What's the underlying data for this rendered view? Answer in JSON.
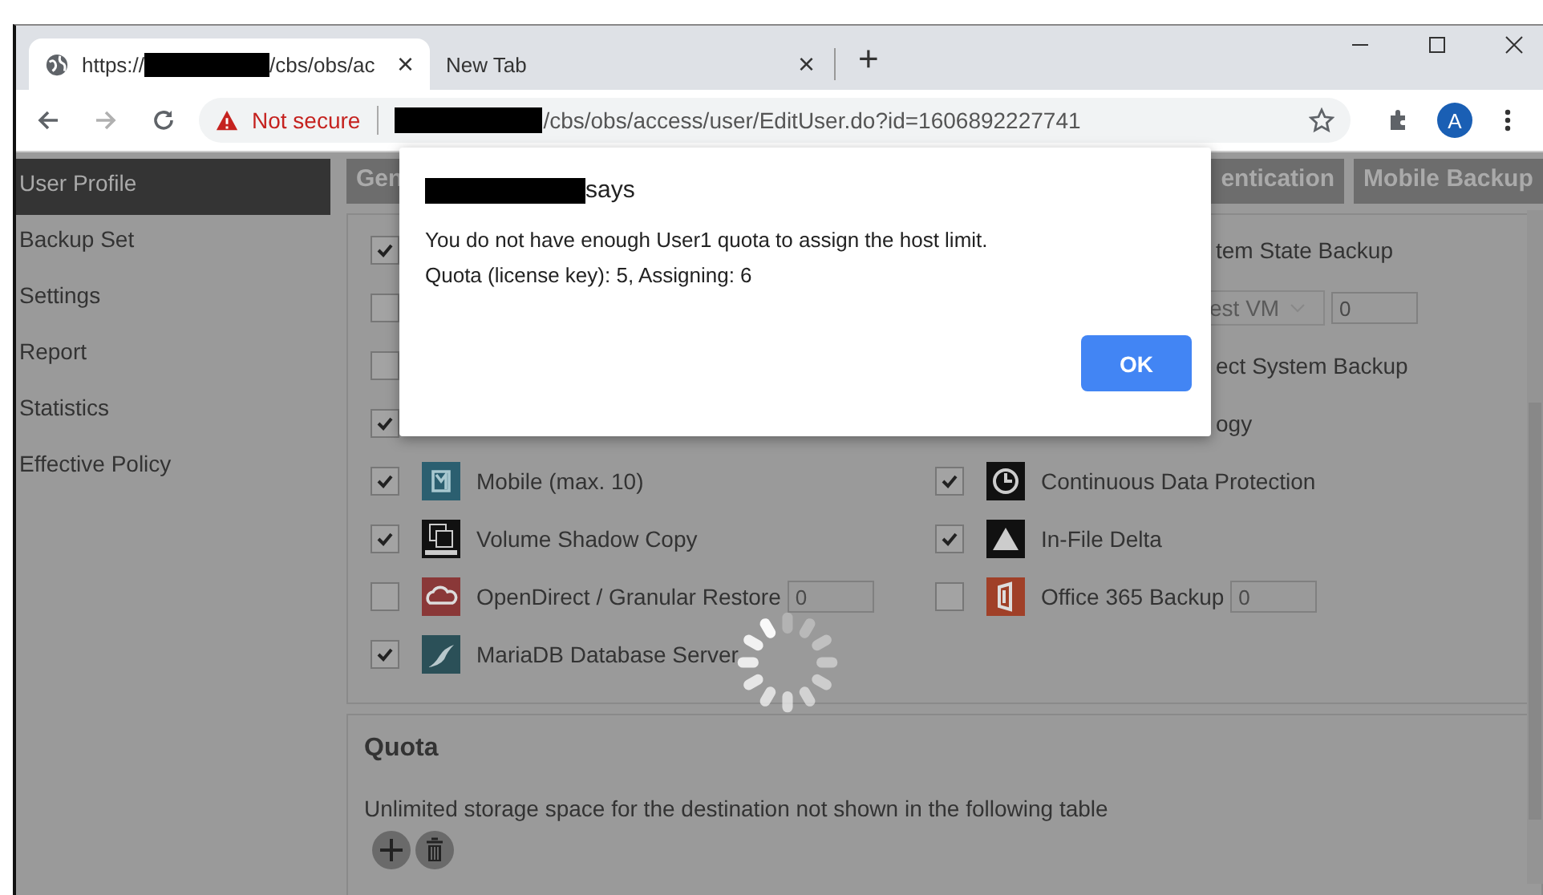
{
  "browser": {
    "tabs": [
      {
        "prefix": "https://",
        "suffix": "/cbs/obs/ac",
        "close": "×",
        "selected": true
      },
      {
        "title": "New Tab",
        "close": "×",
        "selected": false
      }
    ],
    "new_tab": "+",
    "security": "Not secure",
    "url_path": "/cbs/obs/access/user/EditUser.do?id=1606892227741",
    "profile": "A"
  },
  "sidebar": {
    "items": [
      {
        "label": "User Profile",
        "selected": true
      },
      {
        "label": "Backup Set",
        "selected": false
      },
      {
        "label": "Settings",
        "selected": false
      },
      {
        "label": "Report",
        "selected": false
      },
      {
        "label": "Statistics",
        "selected": false
      },
      {
        "label": "Effective Policy",
        "selected": false
      }
    ]
  },
  "tabs": [
    {
      "label": "Gen"
    },
    {
      "label": "entication"
    },
    {
      "label": "Mobile Backup"
    }
  ],
  "features": {
    "left": [
      {
        "kind": "covered",
        "checked": true
      },
      {
        "kind": "covered",
        "checked": false
      },
      {
        "kind": "covered",
        "checked": false
      },
      {
        "kind": "covered",
        "checked": true
      },
      {
        "kind": "option",
        "checked": true,
        "label": "Mobile (max. 10)"
      },
      {
        "kind": "option",
        "checked": true,
        "label": "Volume Shadow Copy"
      },
      {
        "kind": "option",
        "checked": false,
        "label": "OpenDirect / Granular Restore",
        "input": "0"
      },
      {
        "kind": "option",
        "checked": true,
        "label": "MariaDB Database Server"
      }
    ],
    "right": [
      {
        "kind": "partial",
        "label": "tem State Backup"
      },
      {
        "kind": "partial-select",
        "value": "est VM",
        "input": "0"
      },
      {
        "kind": "partial",
        "label": "ect System Backup"
      },
      {
        "kind": "partial",
        "label": "ogy"
      },
      {
        "kind": "option",
        "checked": true,
        "label": "Continuous Data Protection"
      },
      {
        "kind": "option",
        "checked": true,
        "label": "In-File Delta"
      },
      {
        "kind": "option",
        "checked": false,
        "label": "Office 365 Backup",
        "input": "0"
      }
    ]
  },
  "quota": {
    "title": "Quota",
    "note": "Unlimited storage space for the destination not shown in the following table"
  },
  "dialog": {
    "says": "says",
    "message": "You do not have enough User1 quota to assign the host limit.",
    "detail": "Quota (license key): 5, Assigning: 6",
    "ok": "OK"
  }
}
